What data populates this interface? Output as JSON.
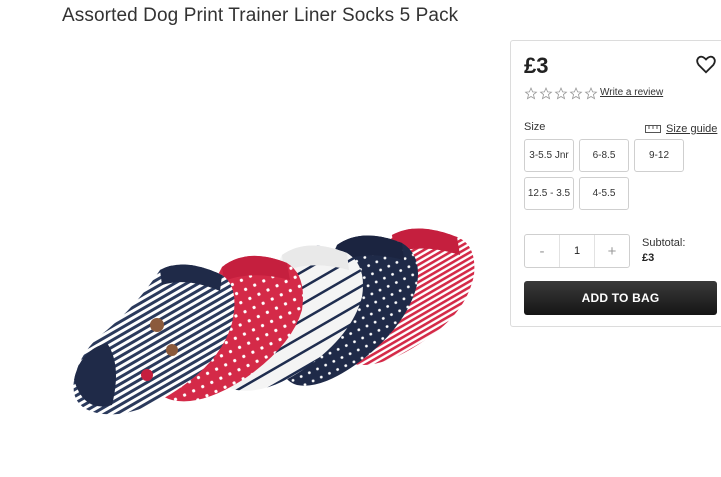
{
  "product": {
    "title": "Assorted Dog Print Trainer Liner Socks 5 Pack",
    "image_icon": "socks-product-image"
  },
  "panel": {
    "price": "£3",
    "wishlist_icon": "heart-icon",
    "rating": {
      "stars_filled": 0,
      "stars_total": 5
    },
    "write_review": "Write a review",
    "size_label": "Size",
    "size_guide": "Size guide",
    "sizes": [
      "3-5.5 Jnr",
      "6-8.5",
      "9-12",
      "12.5 - 3.5",
      "4-5.5"
    ],
    "quantity": {
      "minus": "-",
      "value": "1",
      "plus": "+"
    },
    "subtotal_label": "Subtotal:",
    "subtotal_value": "£3",
    "add_to_bag": "ADD TO BAG"
  }
}
